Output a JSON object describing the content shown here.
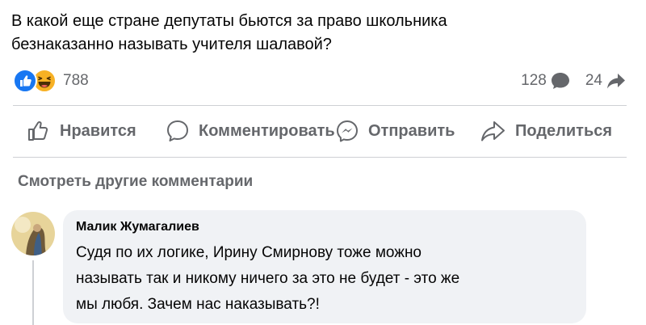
{
  "post": {
    "text_lines": [
      "В какой еще стране депутаты бьются за право школьника",
      "безнаказанно называть учителя шалавой?"
    ]
  },
  "reactions": {
    "icons": [
      "like-icon",
      "haha-icon"
    ],
    "count": "788"
  },
  "counts": {
    "comments": "128",
    "shares": "24"
  },
  "actions": {
    "like_label": "Нравится",
    "comment_label": "Комментировать",
    "send_label": "Отправить",
    "share_label": "Поделиться"
  },
  "comments": {
    "see_more_label": "Смотреть другие комментарии",
    "items": [
      {
        "author": "Малик Жумагалиев",
        "text_lines": [
          "Судя по их логике, Ирину Смирнову тоже можно",
          "называть так и никому ничего за это не будет - это же",
          "мы любя. Зачем нас наказывать?!"
        ]
      }
    ]
  },
  "colors": {
    "like_blue": "#1877f2",
    "haha_yellow": "#f7b125",
    "secondary_text": "#65676b",
    "bubble_bg": "#f0f2f5"
  }
}
